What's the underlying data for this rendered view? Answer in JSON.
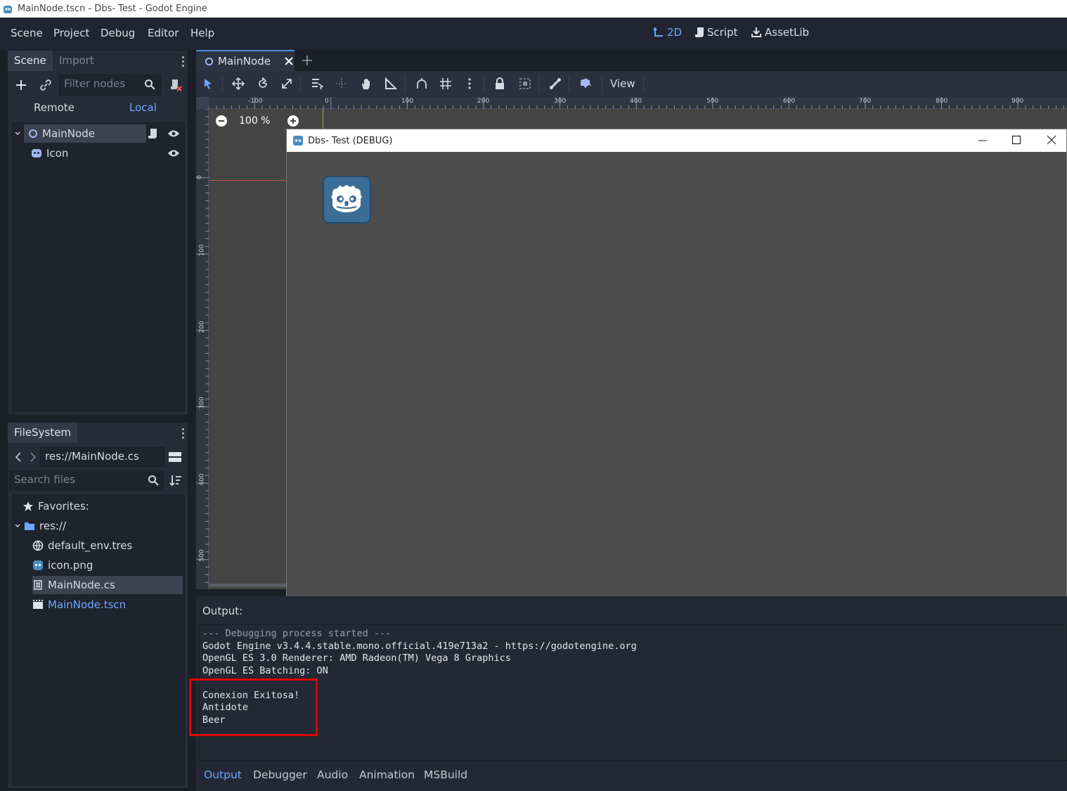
{
  "window": {
    "title": "MainNode.tscn - Dbs- Test - Godot Engine"
  },
  "menubar": {
    "items": [
      "Scene",
      "Project",
      "Debug",
      "Editor",
      "Help"
    ],
    "workspaces": [
      {
        "label": "2D",
        "icon": "2d-icon",
        "active": true
      },
      {
        "label": "Script",
        "icon": "script-icon",
        "active": false
      },
      {
        "label": "AssetLib",
        "icon": "assetlib-icon",
        "active": false
      }
    ]
  },
  "scene_dock": {
    "tabs": [
      "Scene",
      "Import"
    ],
    "filter_placeholder": "Filter nodes",
    "remote_label": "Remote",
    "local_label": "Local",
    "nodes": [
      {
        "label": "MainNode",
        "icon": "node2d-icon"
      },
      {
        "label": "Icon",
        "icon": "sprite-icon"
      }
    ]
  },
  "filesystem_dock": {
    "tab": "FileSystem",
    "path": "res://MainNode.cs",
    "search_placeholder": "Search files",
    "favorites_label": "Favorites:",
    "root_label": "res://",
    "files": [
      {
        "label": "default_env.tres",
        "icon": "environment-icon"
      },
      {
        "label": "icon.png",
        "icon": "image-icon"
      },
      {
        "label": "MainNode.cs",
        "icon": "csharp-script-icon"
      },
      {
        "label": "MainNode.tscn",
        "icon": "scene-file-icon"
      }
    ]
  },
  "editor": {
    "scene_tab": "MainNode",
    "view_label": "View",
    "zoom_label": "100 %",
    "ruler_h_ticks": [
      "-100",
      "0",
      "100",
      "200",
      "300",
      "400",
      "500",
      "600",
      "700",
      "800",
      "900"
    ],
    "ruler_v_ticks": [
      "0",
      "100",
      "200",
      "300",
      "400",
      "500"
    ]
  },
  "game_window": {
    "title": "Dbs- Test (DEBUG)"
  },
  "output_panel": {
    "label": "Output:",
    "lines": [
      "--- Debugging process started ---",
      "Godot Engine v3.4.4.stable.mono.official.419e713a2 - https://godotengine.org",
      "OpenGL ES 3.0 Renderer: AMD Radeon(TM) Vega 8 Graphics",
      "OpenGL ES Batching: ON",
      "",
      "Conexion Exitosa!",
      "Antidote",
      "Beer"
    ],
    "tabs": [
      "Output",
      "Debugger",
      "Audio",
      "Animation",
      "MSBuild"
    ]
  },
  "colors": {
    "accent": "#6da8ff",
    "highlight_box": "#e00000",
    "editor_bg": "#202531"
  }
}
